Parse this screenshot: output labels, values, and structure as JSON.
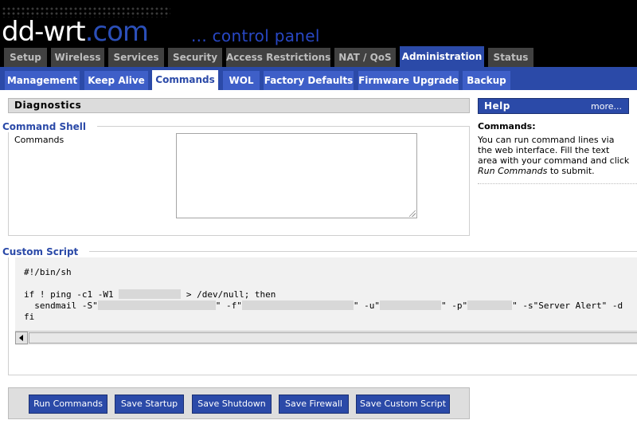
{
  "header": {
    "logo_main": "dd-wrt",
    "logo_suffix": ".com",
    "subtitle": "... control panel"
  },
  "main_tabs": [
    {
      "label": "Setup"
    },
    {
      "label": "Wireless"
    },
    {
      "label": "Services"
    },
    {
      "label": "Security"
    },
    {
      "label": "Access Restrictions"
    },
    {
      "label": "NAT / QoS"
    },
    {
      "label": "Administration"
    },
    {
      "label": "Status"
    }
  ],
  "active_main_tab": "Administration",
  "sub_tabs": [
    {
      "label": "Management"
    },
    {
      "label": "Keep Alive"
    },
    {
      "label": "Commands"
    },
    {
      "label": "WOL"
    },
    {
      "label": "Factory Defaults"
    },
    {
      "label": "Firmware Upgrade"
    },
    {
      "label": "Backup"
    }
  ],
  "active_sub_tab": "Commands",
  "diagnostics": {
    "title": "Diagnostics",
    "command_shell_legend": "Command Shell",
    "commands_label": "Commands",
    "commands_value": "",
    "custom_script_legend": "Custom Script",
    "script": {
      "line1": "#!/bin/sh",
      "line3_pre": "if ! ping -c1 -W1 ",
      "line3_post": " > /dev/null; then",
      "line4_a": "  sendmail -S\"",
      "line4_b": "\" -f\"",
      "line4_c": "\" -u\"",
      "line4_d": "\" -p\"",
      "line4_e": "\" -s\"Server Alert\" -d",
      "line5": "fi"
    }
  },
  "buttons": {
    "run_commands": "Run Commands",
    "save_startup": "Save Startup",
    "save_shutdown": "Save Shutdown",
    "save_firewall": "Save Firewall",
    "save_custom_script": "Save Custom Script"
  },
  "help": {
    "title": "Help",
    "more": "more...",
    "heading": "Commands:",
    "text_before": "You can run command lines via the web interface. Fill the text area with your command and click ",
    "text_em": "Run Commands",
    "text_after": " to submit."
  },
  "colors": {
    "accent_blue": "#2b4aa8",
    "tab_gray": "#414141",
    "header_black": "#000000"
  }
}
